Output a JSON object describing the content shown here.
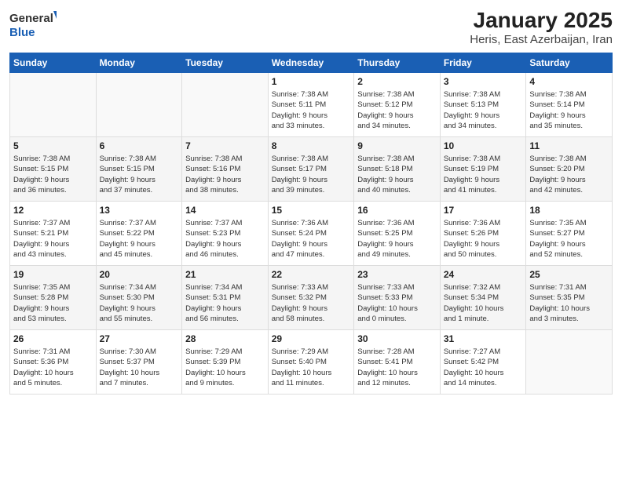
{
  "header": {
    "logo_line1": "General",
    "logo_line2": "Blue",
    "month": "January 2025",
    "location": "Heris, East Azerbaijan, Iran"
  },
  "weekdays": [
    "Sunday",
    "Monday",
    "Tuesday",
    "Wednesday",
    "Thursday",
    "Friday",
    "Saturday"
  ],
  "weeks": [
    [
      {
        "day": "",
        "info": ""
      },
      {
        "day": "",
        "info": ""
      },
      {
        "day": "",
        "info": ""
      },
      {
        "day": "1",
        "info": "Sunrise: 7:38 AM\nSunset: 5:11 PM\nDaylight: 9 hours\nand 33 minutes."
      },
      {
        "day": "2",
        "info": "Sunrise: 7:38 AM\nSunset: 5:12 PM\nDaylight: 9 hours\nand 34 minutes."
      },
      {
        "day": "3",
        "info": "Sunrise: 7:38 AM\nSunset: 5:13 PM\nDaylight: 9 hours\nand 34 minutes."
      },
      {
        "day": "4",
        "info": "Sunrise: 7:38 AM\nSunset: 5:14 PM\nDaylight: 9 hours\nand 35 minutes."
      }
    ],
    [
      {
        "day": "5",
        "info": "Sunrise: 7:38 AM\nSunset: 5:15 PM\nDaylight: 9 hours\nand 36 minutes."
      },
      {
        "day": "6",
        "info": "Sunrise: 7:38 AM\nSunset: 5:15 PM\nDaylight: 9 hours\nand 37 minutes."
      },
      {
        "day": "7",
        "info": "Sunrise: 7:38 AM\nSunset: 5:16 PM\nDaylight: 9 hours\nand 38 minutes."
      },
      {
        "day": "8",
        "info": "Sunrise: 7:38 AM\nSunset: 5:17 PM\nDaylight: 9 hours\nand 39 minutes."
      },
      {
        "day": "9",
        "info": "Sunrise: 7:38 AM\nSunset: 5:18 PM\nDaylight: 9 hours\nand 40 minutes."
      },
      {
        "day": "10",
        "info": "Sunrise: 7:38 AM\nSunset: 5:19 PM\nDaylight: 9 hours\nand 41 minutes."
      },
      {
        "day": "11",
        "info": "Sunrise: 7:38 AM\nSunset: 5:20 PM\nDaylight: 9 hours\nand 42 minutes."
      }
    ],
    [
      {
        "day": "12",
        "info": "Sunrise: 7:37 AM\nSunset: 5:21 PM\nDaylight: 9 hours\nand 43 minutes."
      },
      {
        "day": "13",
        "info": "Sunrise: 7:37 AM\nSunset: 5:22 PM\nDaylight: 9 hours\nand 45 minutes."
      },
      {
        "day": "14",
        "info": "Sunrise: 7:37 AM\nSunset: 5:23 PM\nDaylight: 9 hours\nand 46 minutes."
      },
      {
        "day": "15",
        "info": "Sunrise: 7:36 AM\nSunset: 5:24 PM\nDaylight: 9 hours\nand 47 minutes."
      },
      {
        "day": "16",
        "info": "Sunrise: 7:36 AM\nSunset: 5:25 PM\nDaylight: 9 hours\nand 49 minutes."
      },
      {
        "day": "17",
        "info": "Sunrise: 7:36 AM\nSunset: 5:26 PM\nDaylight: 9 hours\nand 50 minutes."
      },
      {
        "day": "18",
        "info": "Sunrise: 7:35 AM\nSunset: 5:27 PM\nDaylight: 9 hours\nand 52 minutes."
      }
    ],
    [
      {
        "day": "19",
        "info": "Sunrise: 7:35 AM\nSunset: 5:28 PM\nDaylight: 9 hours\nand 53 minutes."
      },
      {
        "day": "20",
        "info": "Sunrise: 7:34 AM\nSunset: 5:30 PM\nDaylight: 9 hours\nand 55 minutes."
      },
      {
        "day": "21",
        "info": "Sunrise: 7:34 AM\nSunset: 5:31 PM\nDaylight: 9 hours\nand 56 minutes."
      },
      {
        "day": "22",
        "info": "Sunrise: 7:33 AM\nSunset: 5:32 PM\nDaylight: 9 hours\nand 58 minutes."
      },
      {
        "day": "23",
        "info": "Sunrise: 7:33 AM\nSunset: 5:33 PM\nDaylight: 10 hours\nand 0 minutes."
      },
      {
        "day": "24",
        "info": "Sunrise: 7:32 AM\nSunset: 5:34 PM\nDaylight: 10 hours\nand 1 minute."
      },
      {
        "day": "25",
        "info": "Sunrise: 7:31 AM\nSunset: 5:35 PM\nDaylight: 10 hours\nand 3 minutes."
      }
    ],
    [
      {
        "day": "26",
        "info": "Sunrise: 7:31 AM\nSunset: 5:36 PM\nDaylight: 10 hours\nand 5 minutes."
      },
      {
        "day": "27",
        "info": "Sunrise: 7:30 AM\nSunset: 5:37 PM\nDaylight: 10 hours\nand 7 minutes."
      },
      {
        "day": "28",
        "info": "Sunrise: 7:29 AM\nSunset: 5:39 PM\nDaylight: 10 hours\nand 9 minutes."
      },
      {
        "day": "29",
        "info": "Sunrise: 7:29 AM\nSunset: 5:40 PM\nDaylight: 10 hours\nand 11 minutes."
      },
      {
        "day": "30",
        "info": "Sunrise: 7:28 AM\nSunset: 5:41 PM\nDaylight: 10 hours\nand 12 minutes."
      },
      {
        "day": "31",
        "info": "Sunrise: 7:27 AM\nSunset: 5:42 PM\nDaylight: 10 hours\nand 14 minutes."
      },
      {
        "day": "",
        "info": ""
      }
    ]
  ]
}
